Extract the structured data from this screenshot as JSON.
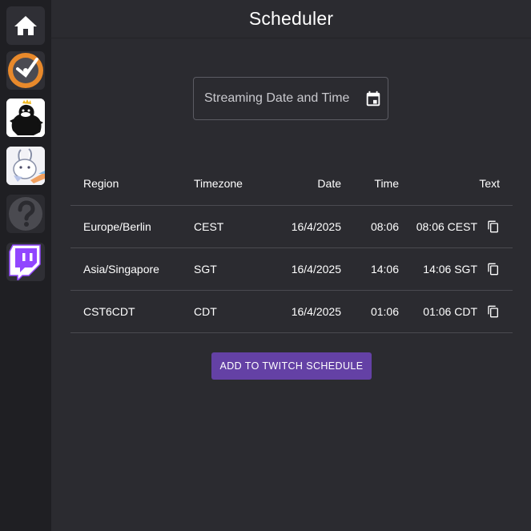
{
  "header": {
    "title": "Scheduler"
  },
  "sidebar": {
    "items": [
      {
        "name": "home",
        "icon": "home-icon"
      },
      {
        "name": "clock-app",
        "icon": "clock-app-icon"
      },
      {
        "name": "crow-app",
        "icon": "crow-avatar-icon"
      },
      {
        "name": "rabbit-app",
        "icon": "rabbit-avatar-icon"
      },
      {
        "name": "unknown-app",
        "icon": "question-mark-icon"
      },
      {
        "name": "twitch",
        "icon": "twitch-icon"
      }
    ]
  },
  "date_field": {
    "placeholder": "Streaming Date and Time",
    "icon": "calendar-icon"
  },
  "table": {
    "headers": {
      "region": "Region",
      "timezone": "Timezone",
      "date": "Date",
      "time": "Time",
      "text": "Text"
    },
    "rows": [
      {
        "region": "Europe/Berlin",
        "timezone": "CEST",
        "date": "16/4/2025",
        "time": "08:06",
        "text": "08:06 CEST"
      },
      {
        "region": "Asia/Singapore",
        "timezone": "SGT",
        "date": "16/4/2025",
        "time": "14:06",
        "text": "14:06 SGT"
      },
      {
        "region": "CST6CDT",
        "timezone": "CDT",
        "date": "16/4/2025",
        "time": "01:06",
        "text": "01:06 CDT"
      }
    ]
  },
  "actions": {
    "add_label": "ADD TO TWITCH SCHEDULE"
  },
  "colors": {
    "background": "#2b2b30",
    "sidebar": "#1f1f23",
    "accent": "#6441a5",
    "clock_orange": "#e8892b",
    "twitch_purple": "#9146ff"
  }
}
